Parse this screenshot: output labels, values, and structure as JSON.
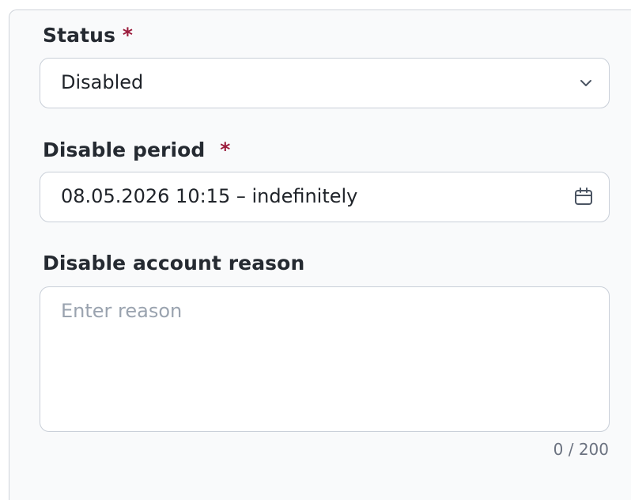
{
  "status": {
    "label": "Status",
    "required_mark": "*",
    "value": "Disabled",
    "icon": "chevron-down-icon"
  },
  "disable_period": {
    "label": "Disable period",
    "required_mark": "*",
    "value": "08.05.2026 10:15 – indefinitely",
    "icon": "calendar-icon"
  },
  "reason": {
    "label": "Disable account reason",
    "placeholder": "Enter reason",
    "counter": "0 / 200"
  },
  "colors": {
    "required": "#9b1c3c",
    "border": "#c9cfd8",
    "background": "#f9fafb"
  }
}
